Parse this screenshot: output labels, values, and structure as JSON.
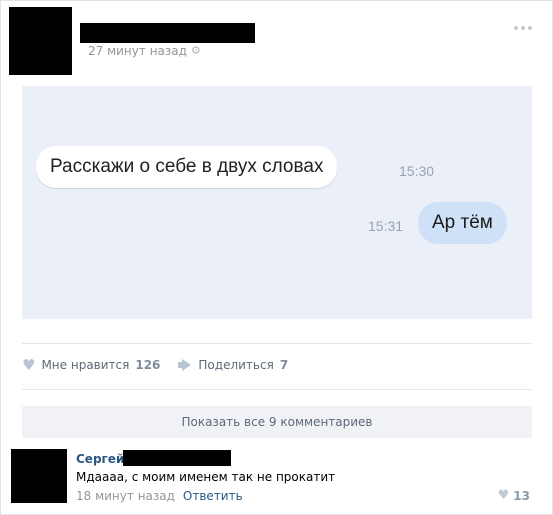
{
  "post": {
    "time": "27 минут назад",
    "messages": [
      {
        "text": "Расскажи о себе в двух словах",
        "time": "15:30"
      },
      {
        "text": "Ар тём",
        "time": "15:31"
      }
    ],
    "likes": {
      "label": "Мне нравится",
      "count": "126"
    },
    "shares": {
      "label": "Поделиться",
      "count": "7"
    }
  },
  "comments": {
    "show_all_label": "Показать все 9 комментариев",
    "items": [
      {
        "author": "Сергей",
        "text": "Мдаааа, с моим именем так не прокатит",
        "time": "18 минут назад",
        "reply_label": "Ответить",
        "likes": "13"
      }
    ]
  },
  "colors": {
    "chat_background": "#ebf0f8",
    "outgoing_bubble": "#cfe1f7",
    "link": "#2a5885"
  }
}
